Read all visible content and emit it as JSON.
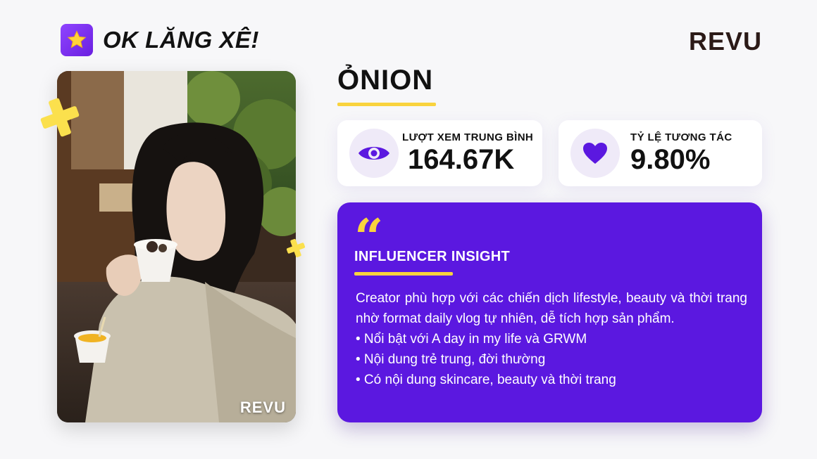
{
  "header": {
    "badge_icon": "star-icon",
    "badge_title": "OK LĂNG XÊ!",
    "brand_logo": "REVU"
  },
  "photo": {
    "watermark": "REVU"
  },
  "profile": {
    "name": "ỎNION"
  },
  "stats": {
    "views": {
      "icon": "eye-icon",
      "label": "LƯỢT XEM TRUNG BÌNH",
      "value": "164.67K"
    },
    "engagement": {
      "icon": "heart-icon",
      "label": "TỶ LỆ TƯƠNG TÁC",
      "value": "9.80%"
    }
  },
  "insight": {
    "quote_mark": "“",
    "title": "INFLUENCER INSIGHT",
    "paragraph": "Creator phù hợp với các chiến dịch lifestyle, beauty và thời trang nhờ format daily vlog tự nhiên, dễ tích hợp sản phẩm.",
    "bullets": [
      "• Nổi bật với A day in my life và GRWM",
      "• Nội dung trẻ trung, đời thường",
      "• Có nội dung skincare, beauty và thời trang"
    ]
  },
  "colors": {
    "accent_purple": "#5b18e0",
    "accent_yellow": "#f9d33d"
  }
}
